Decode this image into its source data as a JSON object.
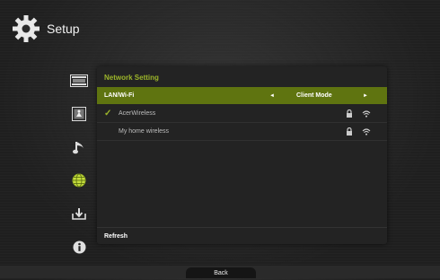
{
  "header": {
    "title": "Setup",
    "icon": "gear-icon"
  },
  "sidebar": {
    "items": [
      {
        "name": "sidebar-item-video",
        "icon": "film-icon"
      },
      {
        "name": "sidebar-item-photo",
        "icon": "photo-icon"
      },
      {
        "name": "sidebar-item-music",
        "icon": "music-note-icon"
      },
      {
        "name": "sidebar-item-network",
        "icon": "globe-icon",
        "active": true
      },
      {
        "name": "sidebar-item-system",
        "icon": "download-icon"
      },
      {
        "name": "sidebar-item-info",
        "icon": "info-icon"
      }
    ]
  },
  "panel": {
    "title": "Network Setting",
    "lan_row": {
      "label": "LAN/Wi-Fi",
      "value": "Client Mode",
      "left_arrow": "◄",
      "right_arrow": "►"
    },
    "networks": [
      {
        "name": "AcerWireless",
        "connected": true,
        "locked": true
      },
      {
        "name": "My home wireless",
        "connected": false,
        "locked": true
      }
    ],
    "refresh_label": "Refresh"
  },
  "footer": {
    "back_label": "Back"
  },
  "colors": {
    "accent": "#9cb52a",
    "selected_row": "#5f7410",
    "panel_bg": "#232323"
  }
}
